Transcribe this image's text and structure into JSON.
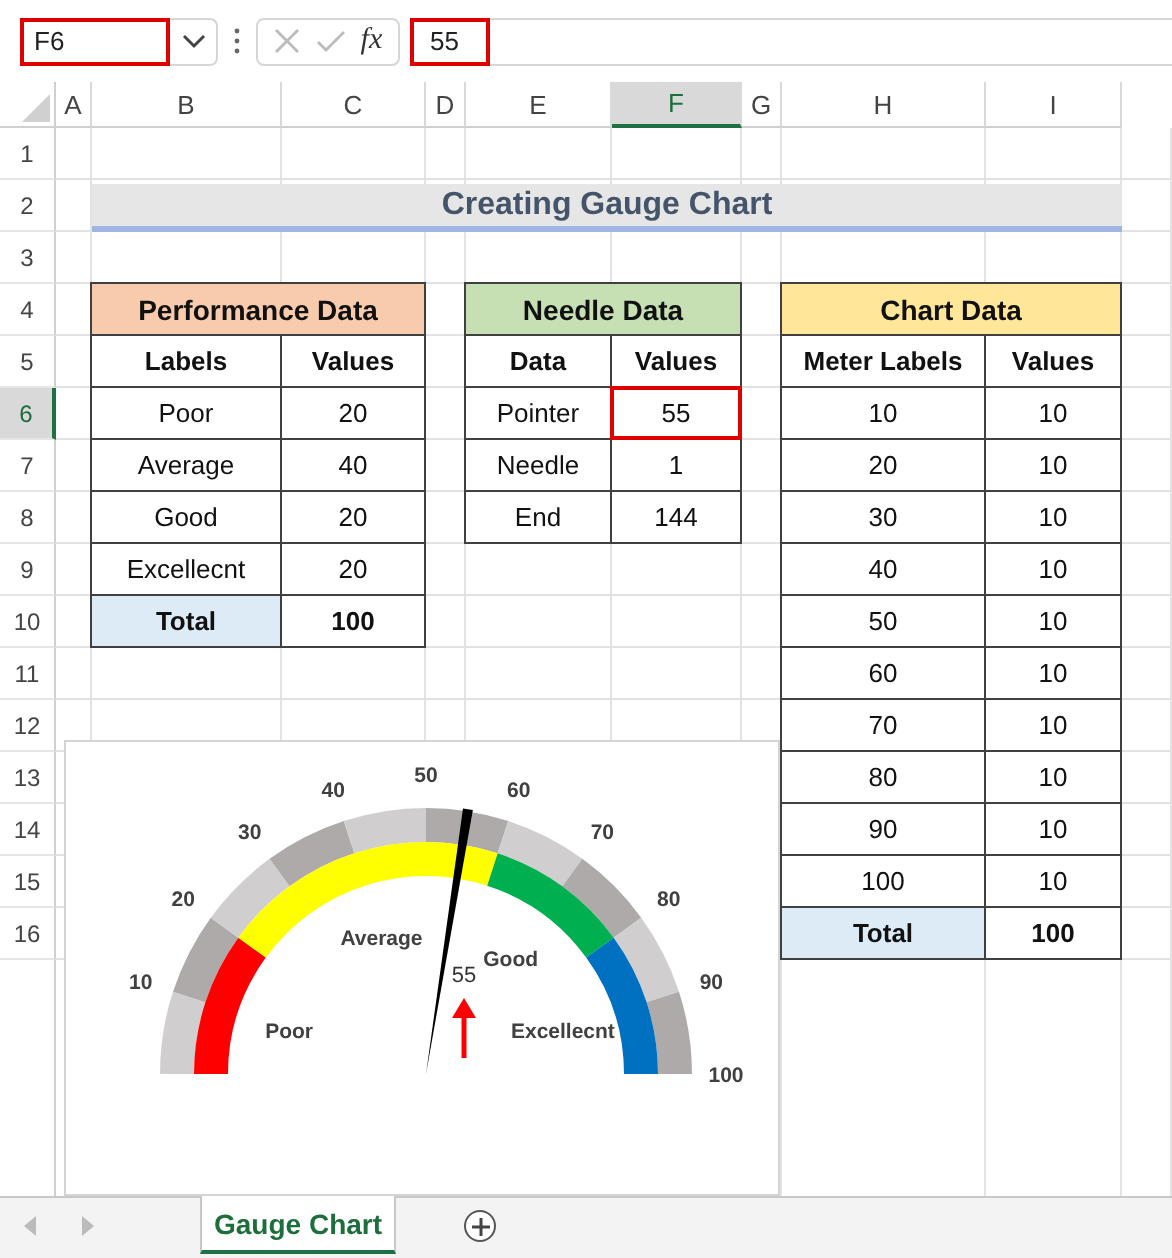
{
  "formula_bar": {
    "name_box": "F6",
    "function_label": "fx",
    "value": "55"
  },
  "columns": [
    {
      "label": "A",
      "selected": false
    },
    {
      "label": "B",
      "selected": false
    },
    {
      "label": "C",
      "selected": false
    },
    {
      "label": "D",
      "selected": false
    },
    {
      "label": "E",
      "selected": false
    },
    {
      "label": "F",
      "selected": true
    },
    {
      "label": "G",
      "selected": false
    },
    {
      "label": "H",
      "selected": false
    },
    {
      "label": "I",
      "selected": false
    }
  ],
  "rows": [
    {
      "label": "1",
      "selected": false
    },
    {
      "label": "2",
      "selected": false
    },
    {
      "label": "3",
      "selected": false
    },
    {
      "label": "4",
      "selected": false
    },
    {
      "label": "5",
      "selected": false
    },
    {
      "label": "6",
      "selected": true
    },
    {
      "label": "7",
      "selected": false
    },
    {
      "label": "8",
      "selected": false
    },
    {
      "label": "9",
      "selected": false
    },
    {
      "label": "10",
      "selected": false
    },
    {
      "label": "11",
      "selected": false
    },
    {
      "label": "12",
      "selected": false
    },
    {
      "label": "13",
      "selected": false
    },
    {
      "label": "14",
      "selected": false
    },
    {
      "label": "15",
      "selected": false
    },
    {
      "label": "16",
      "selected": false
    }
  ],
  "title": "Creating Gauge Chart",
  "tables": [
    {
      "title": "Performance Data",
      "color": "#f8cbad",
      "columns": [
        "Labels",
        "Values"
      ],
      "rows": [
        [
          {
            "text": "Poor",
            "selected": false
          },
          {
            "text": "20",
            "selected": false
          }
        ],
        [
          {
            "text": "Average",
            "selected": false
          },
          {
            "text": "40",
            "selected": false
          }
        ],
        [
          {
            "text": "Good",
            "selected": false
          },
          {
            "text": "20",
            "selected": false
          }
        ],
        [
          {
            "text": "Excellecnt",
            "selected": false
          },
          {
            "text": "20",
            "selected": false
          }
        ]
      ],
      "total": [
        "Total",
        "100"
      ]
    },
    {
      "title": "Needle Data",
      "color": "#c6e0b4",
      "columns": [
        "Data",
        "Values"
      ],
      "rows": [
        [
          {
            "text": "Pointer",
            "selected": false
          },
          {
            "text": "55",
            "selected": true
          }
        ],
        [
          {
            "text": "Needle",
            "selected": false
          },
          {
            "text": "1",
            "selected": false
          }
        ],
        [
          {
            "text": "End",
            "selected": false
          },
          {
            "text": "144",
            "selected": false
          }
        ]
      ]
    },
    {
      "title": "Chart Data",
      "color": "#ffe699",
      "columns": [
        "Meter Labels",
        "Values"
      ],
      "rows": [
        [
          {
            "text": "10",
            "selected": false
          },
          {
            "text": "10",
            "selected": false
          }
        ],
        [
          {
            "text": "20",
            "selected": false
          },
          {
            "text": "10",
            "selected": false
          }
        ],
        [
          {
            "text": "30",
            "selected": false
          },
          {
            "text": "10",
            "selected": false
          }
        ],
        [
          {
            "text": "40",
            "selected": false
          },
          {
            "text": "10",
            "selected": false
          }
        ],
        [
          {
            "text": "50",
            "selected": false
          },
          {
            "text": "10",
            "selected": false
          }
        ],
        [
          {
            "text": "60",
            "selected": false
          },
          {
            "text": "10",
            "selected": false
          }
        ],
        [
          {
            "text": "70",
            "selected": false
          },
          {
            "text": "10",
            "selected": false
          }
        ],
        [
          {
            "text": "80",
            "selected": false
          },
          {
            "text": "10",
            "selected": false
          }
        ],
        [
          {
            "text": "90",
            "selected": false
          },
          {
            "text": "10",
            "selected": false
          }
        ],
        [
          {
            "text": "100",
            "selected": false
          },
          {
            "text": "10",
            "selected": false
          }
        ]
      ],
      "total": [
        "Total",
        "100"
      ]
    }
  ],
  "chart": {
    "ticks": [
      "10",
      "20",
      "30",
      "40",
      "50",
      "60",
      "70",
      "80",
      "90",
      "100"
    ],
    "segments": [
      {
        "label": "Poor",
        "color": "#ff0000"
      },
      {
        "label": "Average",
        "color": "#ffff00"
      },
      {
        "label": "Good",
        "color": "#00b050"
      },
      {
        "label": "Excellecnt",
        "color": "#0070c0"
      }
    ],
    "needle": {
      "level": 0.55,
      "reading": "55"
    }
  },
  "sheet_tabs": [
    {
      "label": "Gauge Chart",
      "selected": true
    }
  ]
}
